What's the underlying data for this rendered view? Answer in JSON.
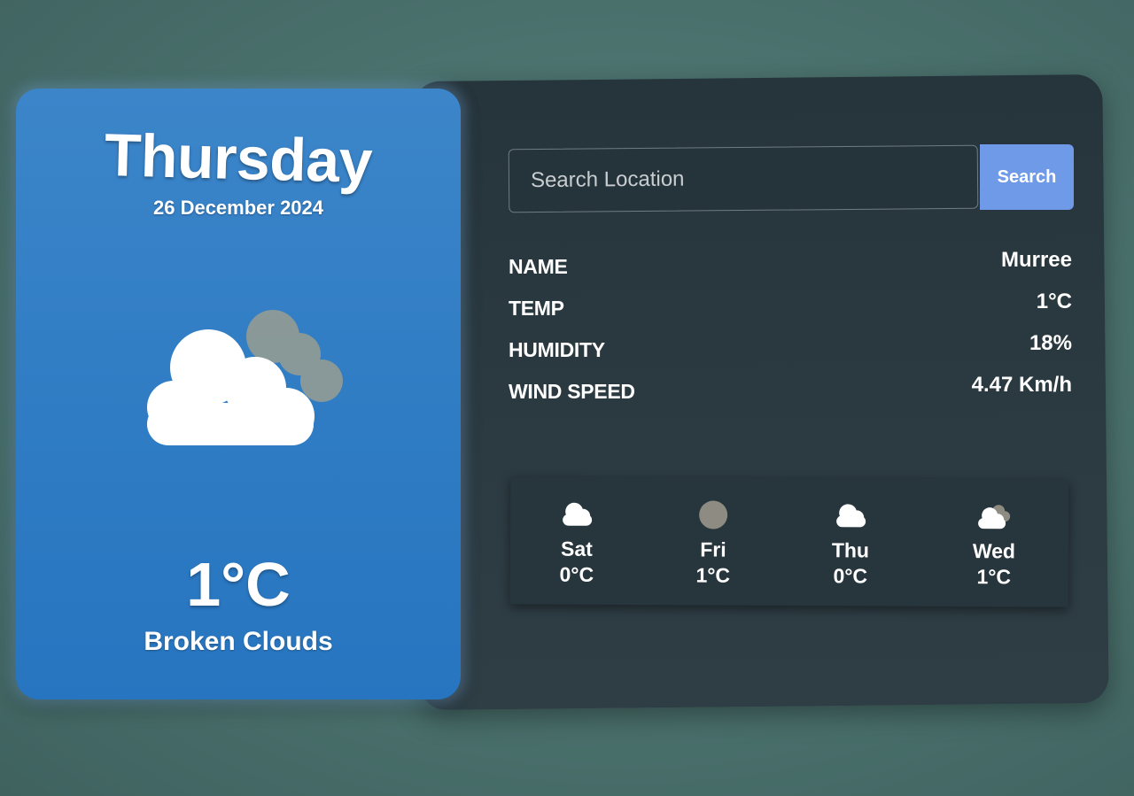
{
  "current": {
    "day": "Thursday",
    "date": "26 December 2024",
    "icon": "broken-clouds-icon",
    "temp": "1°C",
    "description": "Broken Clouds"
  },
  "search": {
    "placeholder": "Search Location",
    "button_label": "Search"
  },
  "details": [
    {
      "label": "NAME",
      "value": "Murree"
    },
    {
      "label": "TEMP",
      "value": "1°C"
    },
    {
      "label": "HUMIDITY",
      "value": "18%"
    },
    {
      "label": "WIND SPEED",
      "value": "4.47 Km/h"
    }
  ],
  "forecast": [
    {
      "day": "Sat",
      "temp": "0°C",
      "icon": "cloud-icon"
    },
    {
      "day": "Fri",
      "temp": "1°C",
      "icon": "moon-icon"
    },
    {
      "day": "Thu",
      "temp": "0°C",
      "icon": "cloud-icon"
    },
    {
      "day": "Wed",
      "temp": "1°C",
      "icon": "broken-clouds-icon"
    }
  ],
  "colors": {
    "card_blue": "#2f7cc4",
    "panel_dark": "#2c3b42",
    "button_blue": "#6f9ae8"
  }
}
